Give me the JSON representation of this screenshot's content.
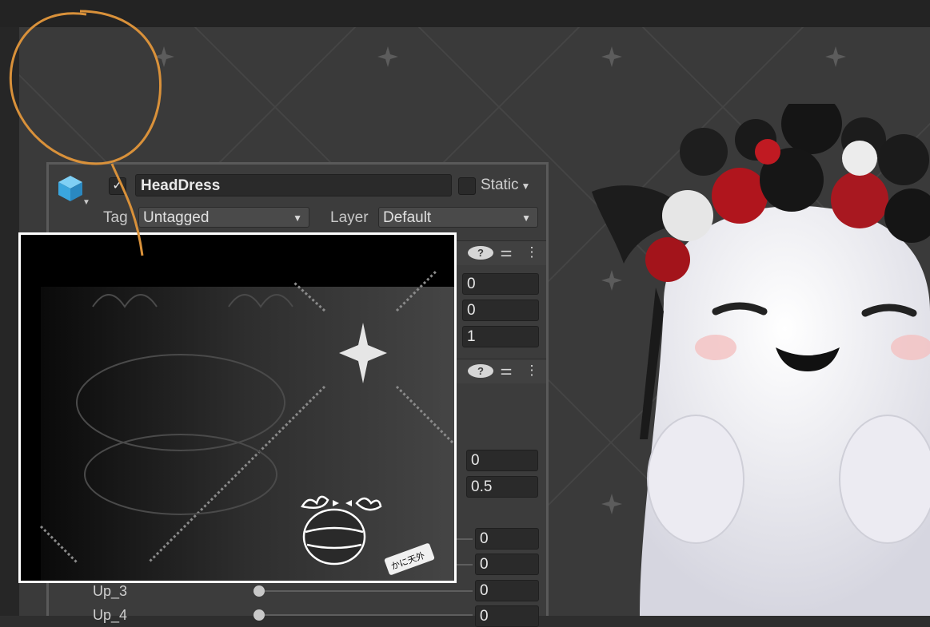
{
  "inspector": {
    "object_name": "HeadDress",
    "active_checked": true,
    "static_label": "Static",
    "tag_label": "Tag",
    "tag_value": "Untagged",
    "layer_label": "Layer",
    "layer_value": "Default"
  },
  "transform_fields": [
    "0",
    "0",
    "1"
  ],
  "material_fields": [
    "0",
    "0.5"
  ],
  "blendshapes": [
    {
      "label": "",
      "value": "0"
    },
    {
      "label": "",
      "value": "0"
    },
    {
      "label": "Up_3",
      "value": "0"
    },
    {
      "label": "Up_4",
      "value": "0"
    }
  ],
  "icons": {
    "object": "cube-icon",
    "help": "help-icon",
    "preset": "sliders-icon",
    "menu": "kebab-menu-icon"
  },
  "colors": {
    "accent_orange": "#d9913a",
    "cube_blue": "#4ab3e6",
    "panel_bg": "#3c3c3c"
  },
  "inset_sticker_text": "かに天外"
}
